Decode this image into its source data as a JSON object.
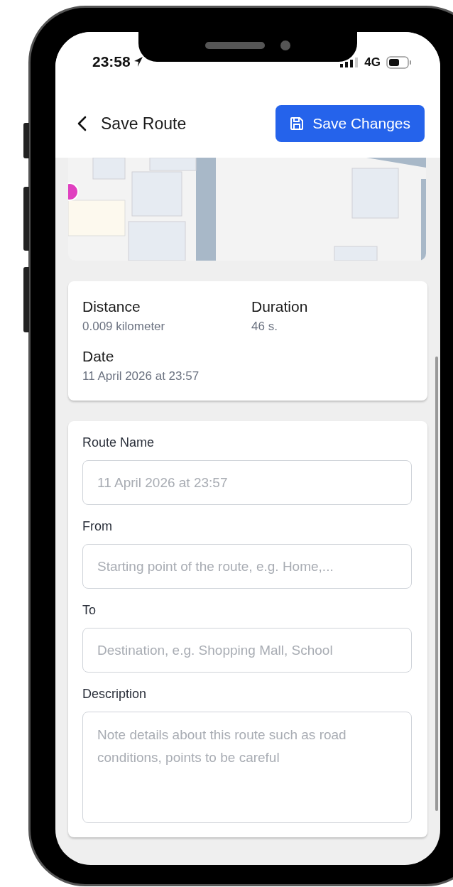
{
  "status_bar": {
    "time": "23:58",
    "network": "4G"
  },
  "header": {
    "title": "Save Route",
    "save_button": "Save Changes"
  },
  "summary": [
    {
      "label": "Distance",
      "value": "0.009 kilometer"
    },
    {
      "label": "Duration",
      "value": "46 s."
    },
    {
      "label": "Date",
      "value": "11 April 2026 at 23:57"
    }
  ],
  "form": [
    {
      "label": "Route Name",
      "kind": "input",
      "placeholder": "11 April 2026 at 23:57"
    },
    {
      "label": "From",
      "kind": "input",
      "placeholder": "Starting point of the route, e.g. Home,..."
    },
    {
      "label": "To",
      "kind": "input",
      "placeholder": "Destination, e.g. Shopping Mall, School"
    },
    {
      "label": "Description",
      "kind": "textarea",
      "placeholder": "Note details about this route such as road conditions, points to be careful"
    }
  ]
}
